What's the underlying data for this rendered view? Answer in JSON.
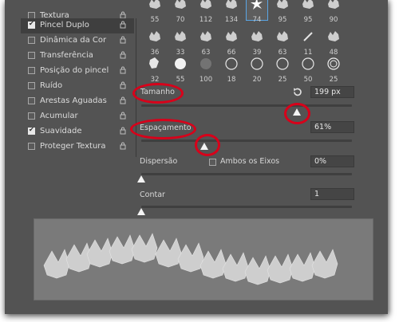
{
  "options": [
    {
      "label": "Textura",
      "checked": false,
      "selected": false
    },
    {
      "label": "Pincel Duplo",
      "checked": true,
      "selected": true
    },
    {
      "label": "Dinâmica da Cor",
      "checked": false,
      "selected": false
    },
    {
      "label": "Transferência",
      "checked": false,
      "selected": false
    },
    {
      "label": "Posição do pincel",
      "checked": false,
      "selected": false
    },
    {
      "label": "Ruído",
      "checked": false,
      "selected": false
    },
    {
      "label": "Arestas Aguadas",
      "checked": false,
      "selected": false
    },
    {
      "label": "Acumular",
      "checked": false,
      "selected": false
    },
    {
      "label": "Suavidade",
      "checked": true,
      "selected": false
    },
    {
      "label": "Proteger Textura",
      "checked": false,
      "selected": false
    }
  ],
  "brushes": {
    "row1": [
      "55",
      "70",
      "112",
      "134",
      "74",
      "95",
      "95",
      "90"
    ],
    "row2": [
      "36",
      "33",
      "63",
      "66",
      "39",
      "63",
      "11",
      "48"
    ],
    "row3": [
      "32",
      "55",
      "100",
      "18",
      "20",
      "25",
      "50",
      "25"
    ],
    "selected_index": 4
  },
  "tamanho": {
    "label": "Tamanho",
    "value": "199 px",
    "reset_icon": "reset-icon"
  },
  "espacamento": {
    "label": "Espaçamento",
    "value": "61%"
  },
  "dispersao": {
    "label": "Dispersão",
    "both_axes_label": "Ambos os Eixos",
    "both_axes_checked": false,
    "value": "0%"
  },
  "contar": {
    "label": "Contar",
    "value": "1"
  },
  "colors": {
    "panel": "#535353",
    "highlight": "#d8001a",
    "selected_brush": "#5aa6e6"
  }
}
